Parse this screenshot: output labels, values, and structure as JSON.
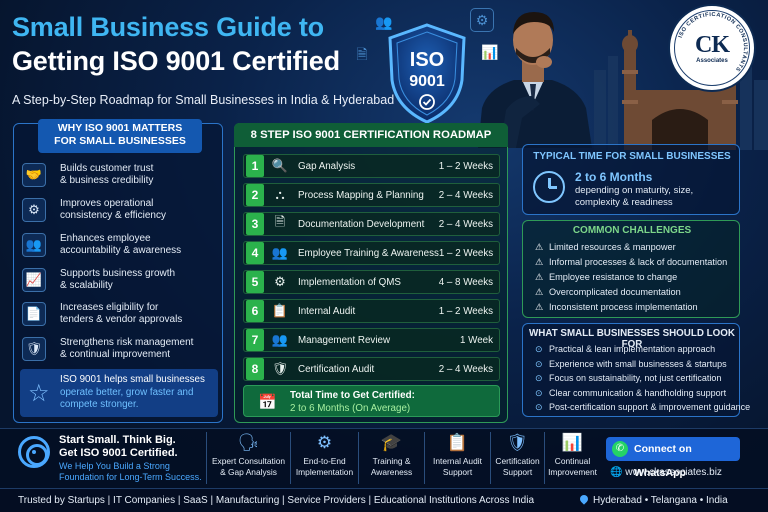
{
  "header": {
    "title_line1": "Small Business Guide to",
    "title_line2": "Getting ISO 9001 Certified",
    "subtitle": "A Step-by-Step Roadmap for Small Businesses in India & Hyderabad"
  },
  "badge": {
    "line1": "ISO",
    "line2": "9001"
  },
  "logo": {
    "initials": "CK",
    "subtext": "Associates",
    "ring_text": "ISO CERTIFICATION CONSULTANTS"
  },
  "why": {
    "heading_line1": "WHY ISO 9001 MATTERS",
    "heading_line2": "FOR SMALL BUSINESSES",
    "items": [
      {
        "icon": "handshake-icon",
        "glyph": "🤝",
        "line1": "Builds customer trust",
        "line2": "& business credibility"
      },
      {
        "icon": "gear-icon",
        "glyph": "⚙",
        "line1": "Improves operational",
        "line2": "consistency & efficiency"
      },
      {
        "icon": "team-icon",
        "glyph": "👥",
        "line1": "Enhances employee",
        "line2": "accountability & awareness"
      },
      {
        "icon": "growth-chart-icon",
        "glyph": "📈",
        "line1": "Supports business growth",
        "line2": "& scalability"
      },
      {
        "icon": "document-icon",
        "glyph": "📄",
        "line1": "Increases eligibility for",
        "line2": "tenders & vendor approvals"
      },
      {
        "icon": "shield-check-icon",
        "glyph": "🛡",
        "line1": "Strengthens risk management",
        "line2": "& continual improvement"
      }
    ],
    "footer_line1": "ISO 9001 helps small businesses",
    "footer_line2": "operate better, grow faster and",
    "footer_line3": "compete stronger."
  },
  "roadmap": {
    "heading": "8 STEP ISO 9001 CERTIFICATION ROADMAP",
    "steps": [
      {
        "num": "1",
        "icon": "magnifier-icon",
        "glyph": "🔍",
        "name": "Gap Analysis",
        "duration": "1 – 2 Weeks"
      },
      {
        "num": "2",
        "icon": "process-map-icon",
        "glyph": "⛬",
        "name": "Process Mapping & Planning",
        "duration": "2 – 4 Weeks"
      },
      {
        "num": "3",
        "icon": "document-icon",
        "glyph": "🗎",
        "name": "Documentation Development",
        "duration": "2 – 4 Weeks"
      },
      {
        "num": "4",
        "icon": "training-icon",
        "glyph": "👥",
        "name": "Employee Training & Awareness",
        "duration": "1 – 2 Weeks"
      },
      {
        "num": "5",
        "icon": "gear-icon",
        "glyph": "⚙",
        "name": "Implementation of QMS",
        "duration": "4 – 8 Weeks"
      },
      {
        "num": "6",
        "icon": "checklist-icon",
        "glyph": "📋",
        "name": "Internal Audit",
        "duration": "1 – 2 Weeks"
      },
      {
        "num": "7",
        "icon": "meeting-icon",
        "glyph": "👥",
        "name": "Management Review",
        "duration": "1 Week"
      },
      {
        "num": "8",
        "icon": "shield-check-icon",
        "glyph": "🛡",
        "name": "Certification Audit",
        "duration": "2 – 4 Weeks"
      }
    ],
    "total_label": "Total Time to Get Certified:",
    "total_value": "2 to 6 Months (On Average)"
  },
  "typical_time": {
    "heading": "TYPICAL TIME FOR SMALL BUSINESSES",
    "value": "2 to 6 Months",
    "line1": "depending on maturity, size,",
    "line2": "complexity & readiness"
  },
  "challenges": {
    "heading": "COMMON CHALLENGES",
    "items": [
      "Limited resources & manpower",
      "Informal processes & lack of documentation",
      "Employee resistance to change",
      "Overcomplicated documentation",
      "Inconsistent process implementation"
    ]
  },
  "look_for": {
    "heading": "WHAT SMALL BUSINESSES SHOULD LOOK FOR",
    "items": [
      "Practical & lean implementation approach",
      "Experience with small businesses & startups",
      "Focus on sustainability, not just certification",
      "Clear communication & handholding support",
      "Post-certification support & improvement guidance"
    ]
  },
  "tagline": {
    "line1": "Start Small. Think Big.",
    "line2": "Get ISO 9001 Certified.",
    "line3": "We Help You Build a Strong Foundation for Long-Term Success."
  },
  "services": [
    {
      "icon": "consultation-icon",
      "glyph": "🗣",
      "line1": "Expert Consultation",
      "line2": "& Gap Analysis"
    },
    {
      "icon": "gear-icon",
      "glyph": "⚙",
      "line1": "End-to-End",
      "line2": "Implementation"
    },
    {
      "icon": "graduation-cap-icon",
      "glyph": "🎓",
      "line1": "Training &",
      "line2": "Awareness"
    },
    {
      "icon": "audit-clipboard-icon",
      "glyph": "📋",
      "line1": "Internal Audit",
      "line2": "Support"
    },
    {
      "icon": "certification-shield-icon",
      "glyph": "🛡",
      "line1": "Certification",
      "line2": "Support"
    },
    {
      "icon": "improvement-chart-icon",
      "glyph": "📊",
      "line1": "Continual",
      "line2": "Improvement"
    }
  ],
  "contact": {
    "whatsapp_label": "Connect on WhatsApp",
    "website": "www.ckassociates.biz"
  },
  "footer": {
    "trusted": "Trusted by Startups  |  IT Companies  |  SaaS  |  Manufacturing  |  Service Providers  |  Educational Institutions Across India",
    "location": "Hyderabad  •  Telangana  •  India"
  },
  "colors": {
    "accent_blue": "#3fb6f2",
    "panel_border_blue": "#2b74c8",
    "panel_border_green": "#2f9a57",
    "step_green": "#2bb24c",
    "whatsapp_green": "#25d366",
    "background_navy": "#06152e"
  }
}
